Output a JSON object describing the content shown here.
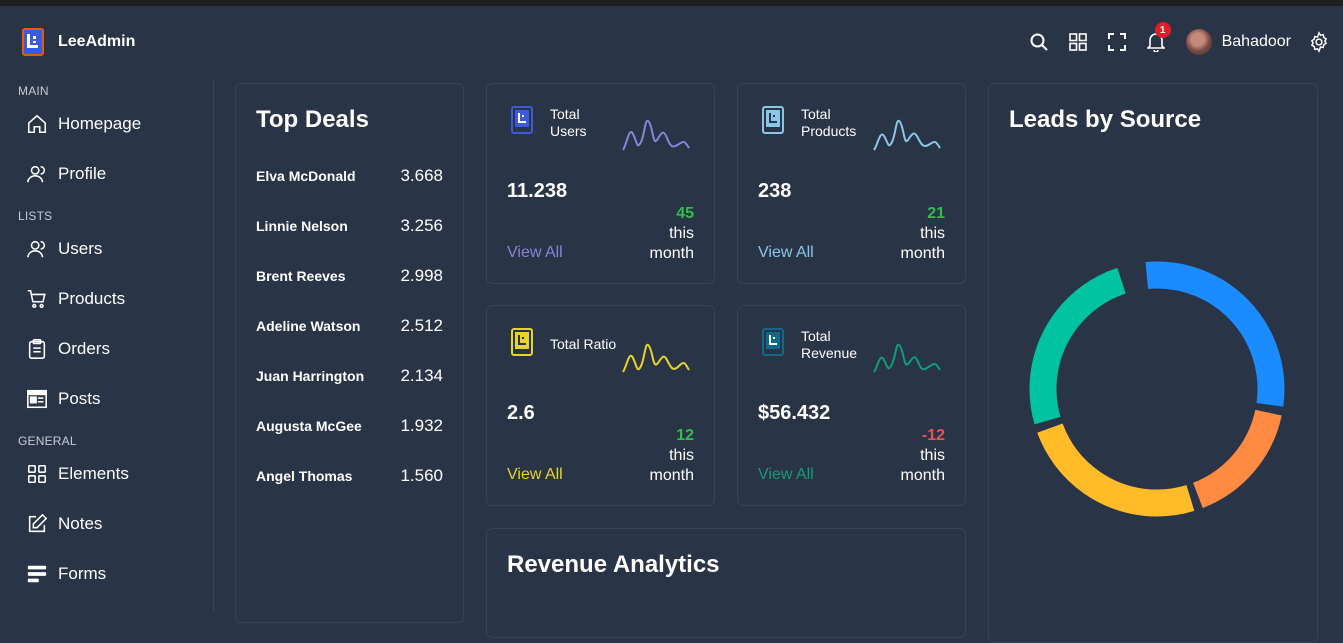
{
  "app": {
    "name": "LeeAdmin"
  },
  "header": {
    "user_name": "Bahadoor",
    "notification_count": "1"
  },
  "sidebar": {
    "sections": [
      {
        "title": "MAIN",
        "items": [
          {
            "label": "Homepage",
            "icon": "home-icon"
          },
          {
            "label": "Profile",
            "icon": "user-icon"
          }
        ]
      },
      {
        "title": "LISTS",
        "items": [
          {
            "label": "Users",
            "icon": "users-icon"
          },
          {
            "label": "Products",
            "icon": "cart-icon"
          },
          {
            "label": "Orders",
            "icon": "clipboard-icon"
          },
          {
            "label": "Posts",
            "icon": "posts-icon"
          }
        ]
      },
      {
        "title": "GENERAL",
        "items": [
          {
            "label": "Elements",
            "icon": "grid-icon"
          },
          {
            "label": "Notes",
            "icon": "edit-icon"
          },
          {
            "label": "Forms",
            "icon": "forms-icon"
          }
        ]
      }
    ]
  },
  "top_deals": {
    "title": "Top Deals",
    "rows": [
      {
        "name": "Elva McDonald",
        "value": "3.668"
      },
      {
        "name": "Linnie Nelson",
        "value": "3.256"
      },
      {
        "name": "Brent Reeves",
        "value": "2.998"
      },
      {
        "name": "Adeline Watson",
        "value": "2.512"
      },
      {
        "name": "Juan Harrington",
        "value": "2.134"
      },
      {
        "name": "Augusta McGee",
        "value": "1.932"
      },
      {
        "name": "Angel Thomas",
        "value": "1.560"
      }
    ]
  },
  "stat_boxes": [
    {
      "label": "Total Users",
      "value": "11.238",
      "change": "45",
      "period_a": "this",
      "period_b": "month",
      "link": "View All",
      "color": "#8884d8",
      "change_color": "#2fbf4a"
    },
    {
      "label": "Total Products",
      "value": "238",
      "change": "21",
      "period_a": "this",
      "period_b": "month",
      "link": "View All",
      "color": "#8ac6e8",
      "change_color": "#2fbf4a"
    },
    {
      "label": "Total Ratio",
      "value": "2.6",
      "change": "12",
      "period_a": "this",
      "period_b": "month",
      "link": "View All",
      "color": "#e8d32a",
      "change_color": "#2fbf4a"
    },
    {
      "label": "Total Revenue",
      "value": "$56.432",
      "change": "-12",
      "period_a": "this",
      "period_b": "month",
      "link": "View All",
      "color": "#0f9d77",
      "change_color": "#f05252"
    }
  ],
  "revenue": {
    "title": "Revenue Analytics"
  },
  "leads": {
    "title": "Leads by Source",
    "colors": {
      "blue": "#1a8cff",
      "orange": "#ff8a42",
      "yellow": "#ffbb28",
      "green": "#00c49f"
    }
  }
}
